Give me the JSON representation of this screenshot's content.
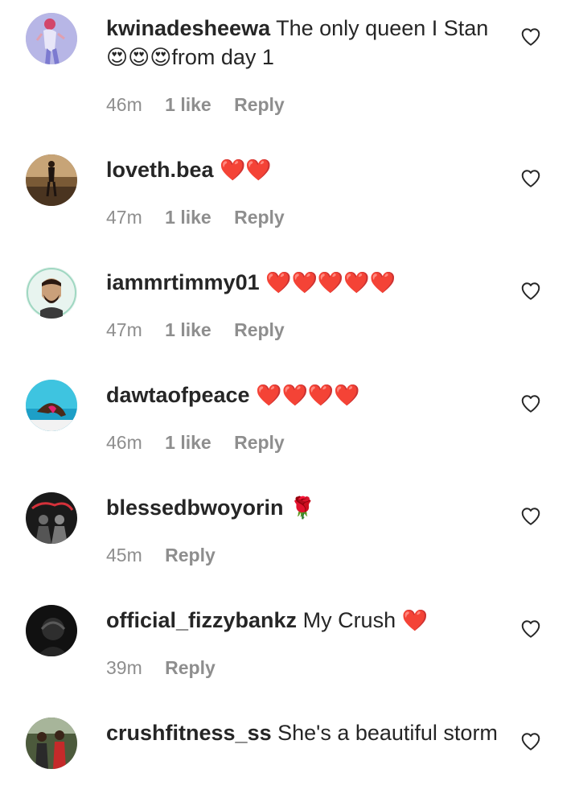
{
  "comments": [
    {
      "username": "kwinadesheewa",
      "text_line1": "The only queen I Stan",
      "emojis_line2": "😍😍😍",
      "text_line2": "from day 1",
      "time": "46m",
      "likes": "1 like",
      "reply": "Reply"
    },
    {
      "username": "loveth.bea",
      "emojis": "❤️❤️",
      "time": "47m",
      "likes": "1 like",
      "reply": "Reply"
    },
    {
      "username": "iammrtimmy01",
      "emojis": "❤️❤️❤️❤️❤️",
      "time": "47m",
      "likes": "1 like",
      "reply": "Reply"
    },
    {
      "username": "dawtaofpeace",
      "emojis": "❤️❤️❤️❤️",
      "time": "46m",
      "likes": "1 like",
      "reply": "Reply"
    },
    {
      "username": "blessedbwoyorin",
      "emojis": "🌹",
      "time": "45m",
      "reply": "Reply"
    },
    {
      "username": "official_fizzybankz",
      "text": "My Crush",
      "emojis": "❤️",
      "time": "39m",
      "reply": "Reply"
    },
    {
      "username": "crushfitness_ss",
      "text": "She's a beautiful storm"
    }
  ],
  "colors": {
    "text": "#262626",
    "meta": "#8e8e8e",
    "heart_emoji": "#e0112b",
    "background": "#ffffff"
  },
  "icons": {
    "like": "heart-outline-icon"
  }
}
